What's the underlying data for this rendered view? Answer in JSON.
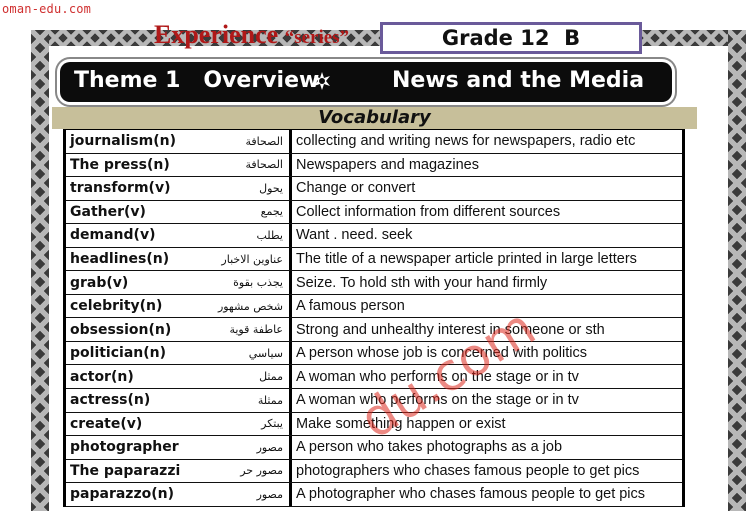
{
  "site": "oman-edu.com",
  "header": {
    "experience": "Experience",
    "series": "“series”",
    "grade": "Grade 12  B"
  },
  "banner": {
    "theme": "Theme 1",
    "overview": "Overview",
    "topic": "News and the Media"
  },
  "section_title": "Vocabulary",
  "watermark": "du.com",
  "vocab": [
    {
      "word": "journalism(n)",
      "arabic": "الصحافة",
      "definition": "collecting and writing news for newspapers, radio etc"
    },
    {
      "word": "The press(n)",
      "arabic": "الصحافة",
      "definition": "Newspapers and magazines"
    },
    {
      "word": "transform(v)",
      "arabic": "يحول",
      "definition": "Change or convert"
    },
    {
      "word": "Gather(v)",
      "arabic": "يجمع",
      "definition": "Collect information from different sources"
    },
    {
      "word": "demand(v)",
      "arabic": "يطلب",
      "definition": "Want . need. seek"
    },
    {
      "word": "headlines(n)",
      "arabic": "عناوين الاخبار",
      "definition": "The title of a newspaper article printed in large letters"
    },
    {
      "word": "grab(v)",
      "arabic": "يجذب بقوة",
      "definition": "Seize. To hold sth with your hand firmly"
    },
    {
      "word": "celebrity(n)",
      "arabic": "شخص مشهور",
      "definition": "A famous person"
    },
    {
      "word": "obsession(n)",
      "arabic": "عاطفة قوية",
      "definition": "Strong and unhealthy interest in someone or sth"
    },
    {
      "word": "politician(n)",
      "arabic": "سياسي",
      "definition": "A person whose job is concerned with politics"
    },
    {
      "word": "actor(n)",
      "arabic": "ممثل",
      "definition": "A woman who performs on the stage or in tv"
    },
    {
      "word": "actress(n)",
      "arabic": "ممثلة",
      "definition": "A woman who performs on the stage or in tv"
    },
    {
      "word": "create(v)",
      "arabic": "يبتكر",
      "definition": "Make something happen or exist"
    },
    {
      "word": "photographer",
      "arabic": "مصور",
      "definition": "A person who takes photographs as a job"
    },
    {
      "word": "The paparazzi",
      "arabic": "مصور حر",
      "definition": "photographers who chases famous people to get pics"
    },
    {
      "word": "paparazzo(n)",
      "arabic": "مصور",
      "definition": "A photographer who chases famous people to get pics"
    }
  ]
}
